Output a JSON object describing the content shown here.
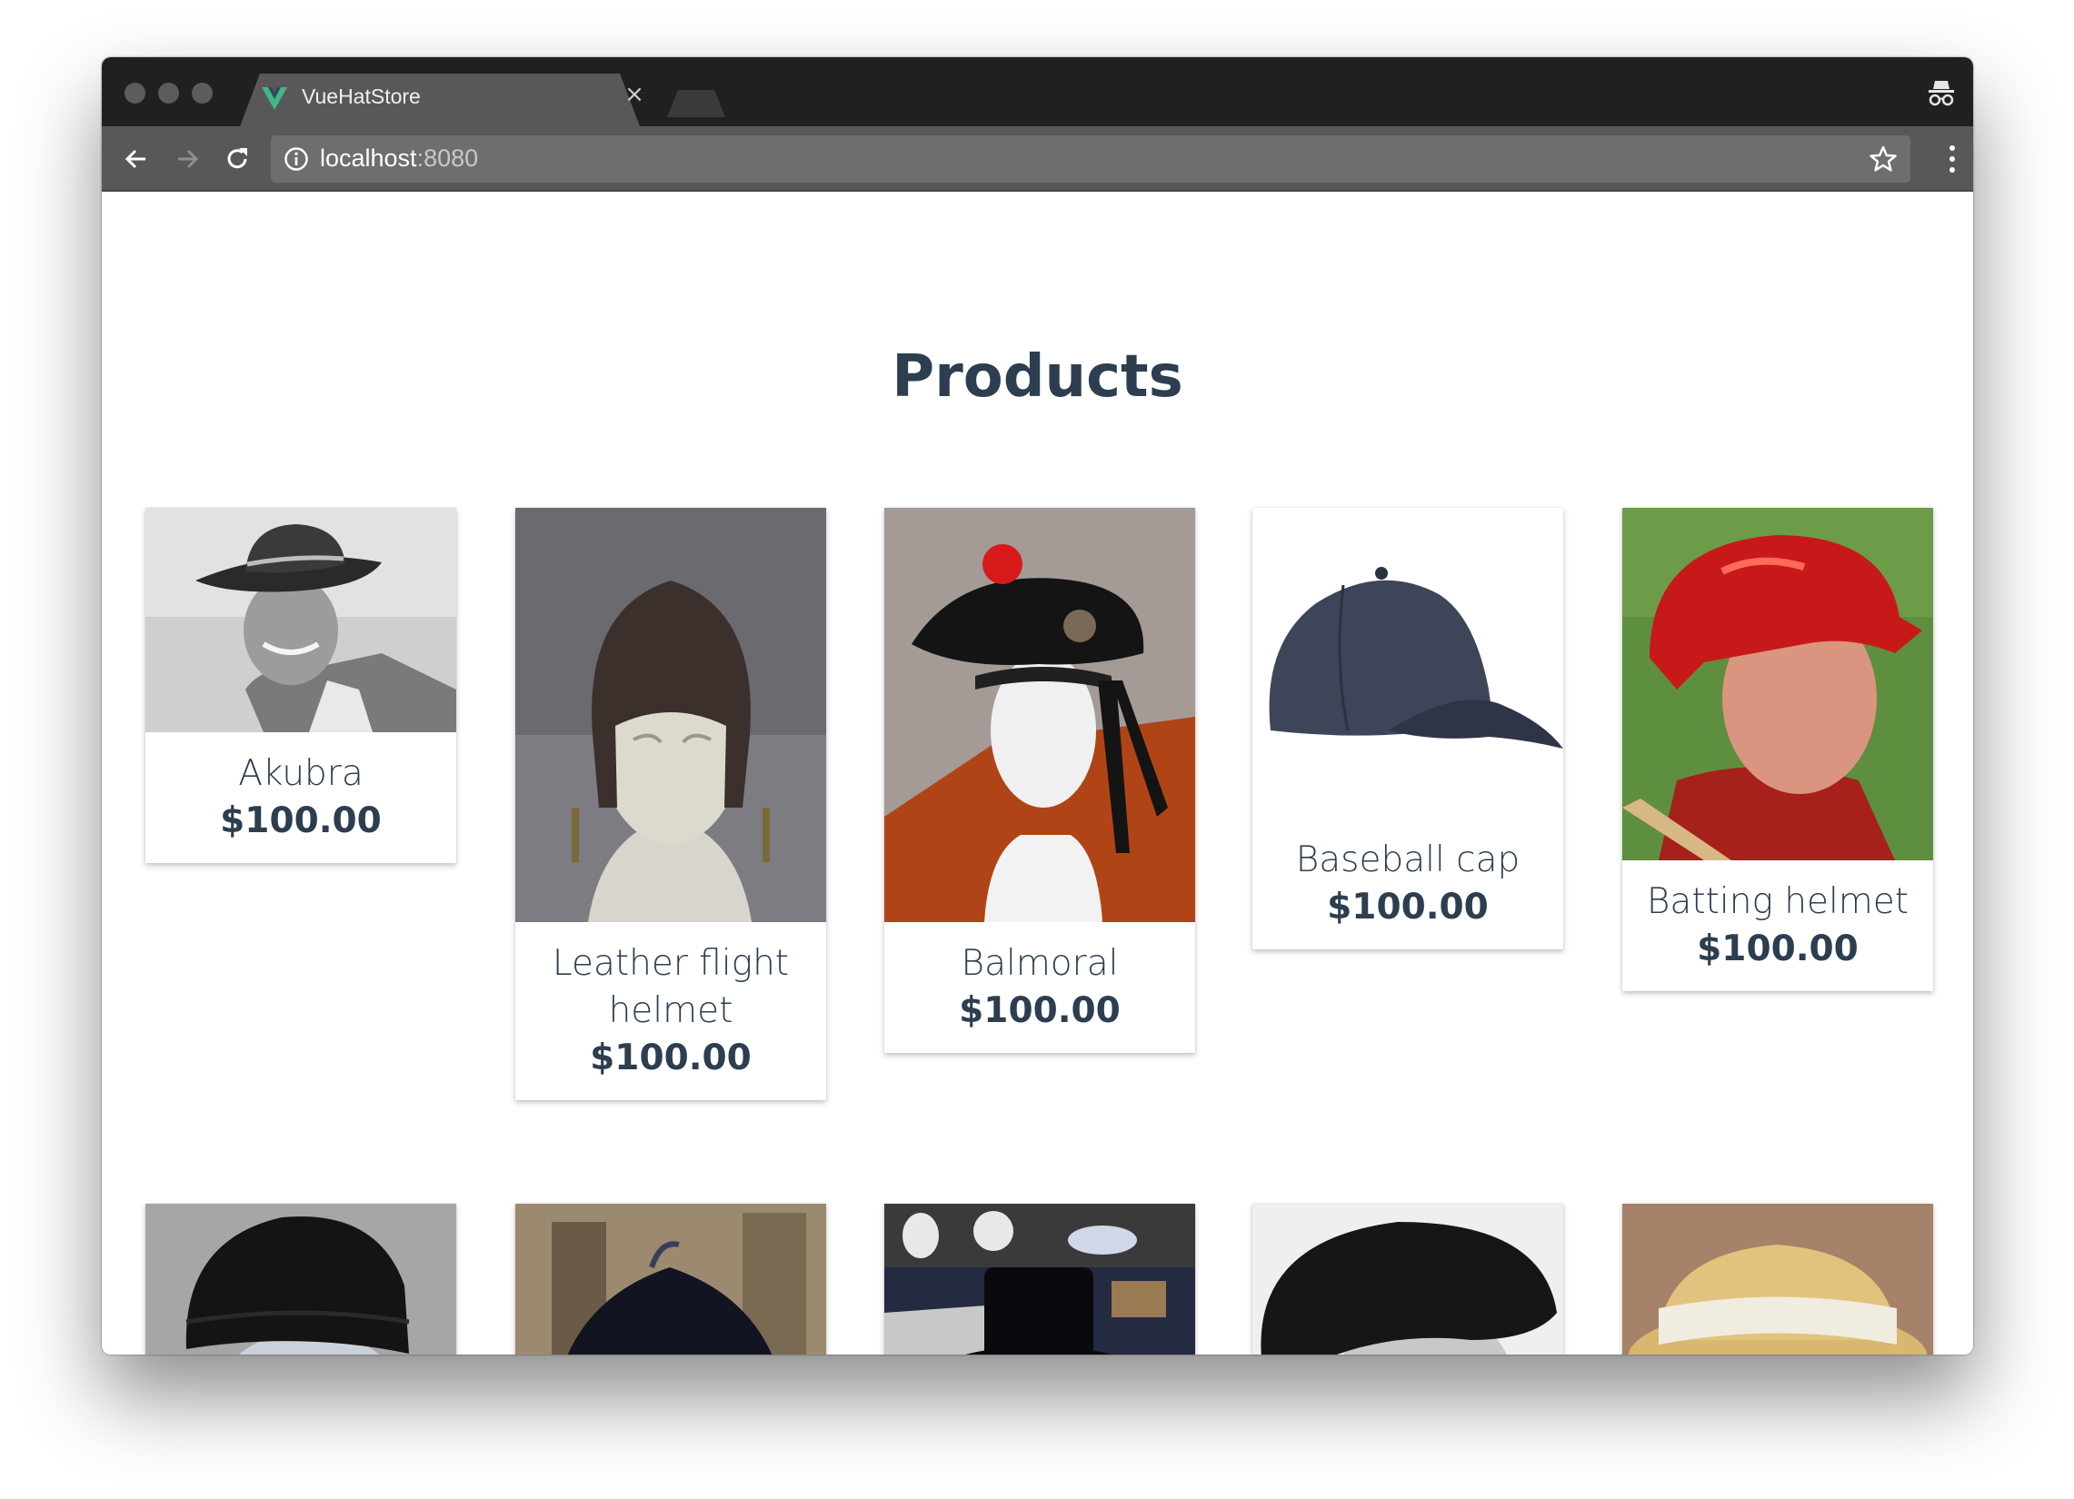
{
  "browser": {
    "tab_title": "VueHatStore",
    "url_host": "localhost",
    "url_port": ":8080"
  },
  "page": {
    "title": "Products"
  },
  "products": [
    {
      "name": "Akubra",
      "price": "$100.00"
    },
    {
      "name": "Leather flight helmet",
      "price": "$100.00"
    },
    {
      "name": "Balmoral",
      "price": "$100.00"
    },
    {
      "name": "Baseball cap",
      "price": "$100.00"
    },
    {
      "name": "Batting helmet",
      "price": "$100.00"
    }
  ],
  "icons": {
    "tab_logo": "vue-logo-icon",
    "close": "close-icon",
    "incognito": "incognito-icon",
    "back": "back-arrow-icon",
    "forward": "forward-arrow-icon",
    "reload": "reload-icon",
    "info": "info-icon",
    "bookmark": "star-icon",
    "menu": "menu-dots-icon"
  },
  "colors": {
    "heading": "#2c3e50",
    "vue_green": "#41b883",
    "titlebar": "#1f2022",
    "toolbar": "#58585a"
  }
}
